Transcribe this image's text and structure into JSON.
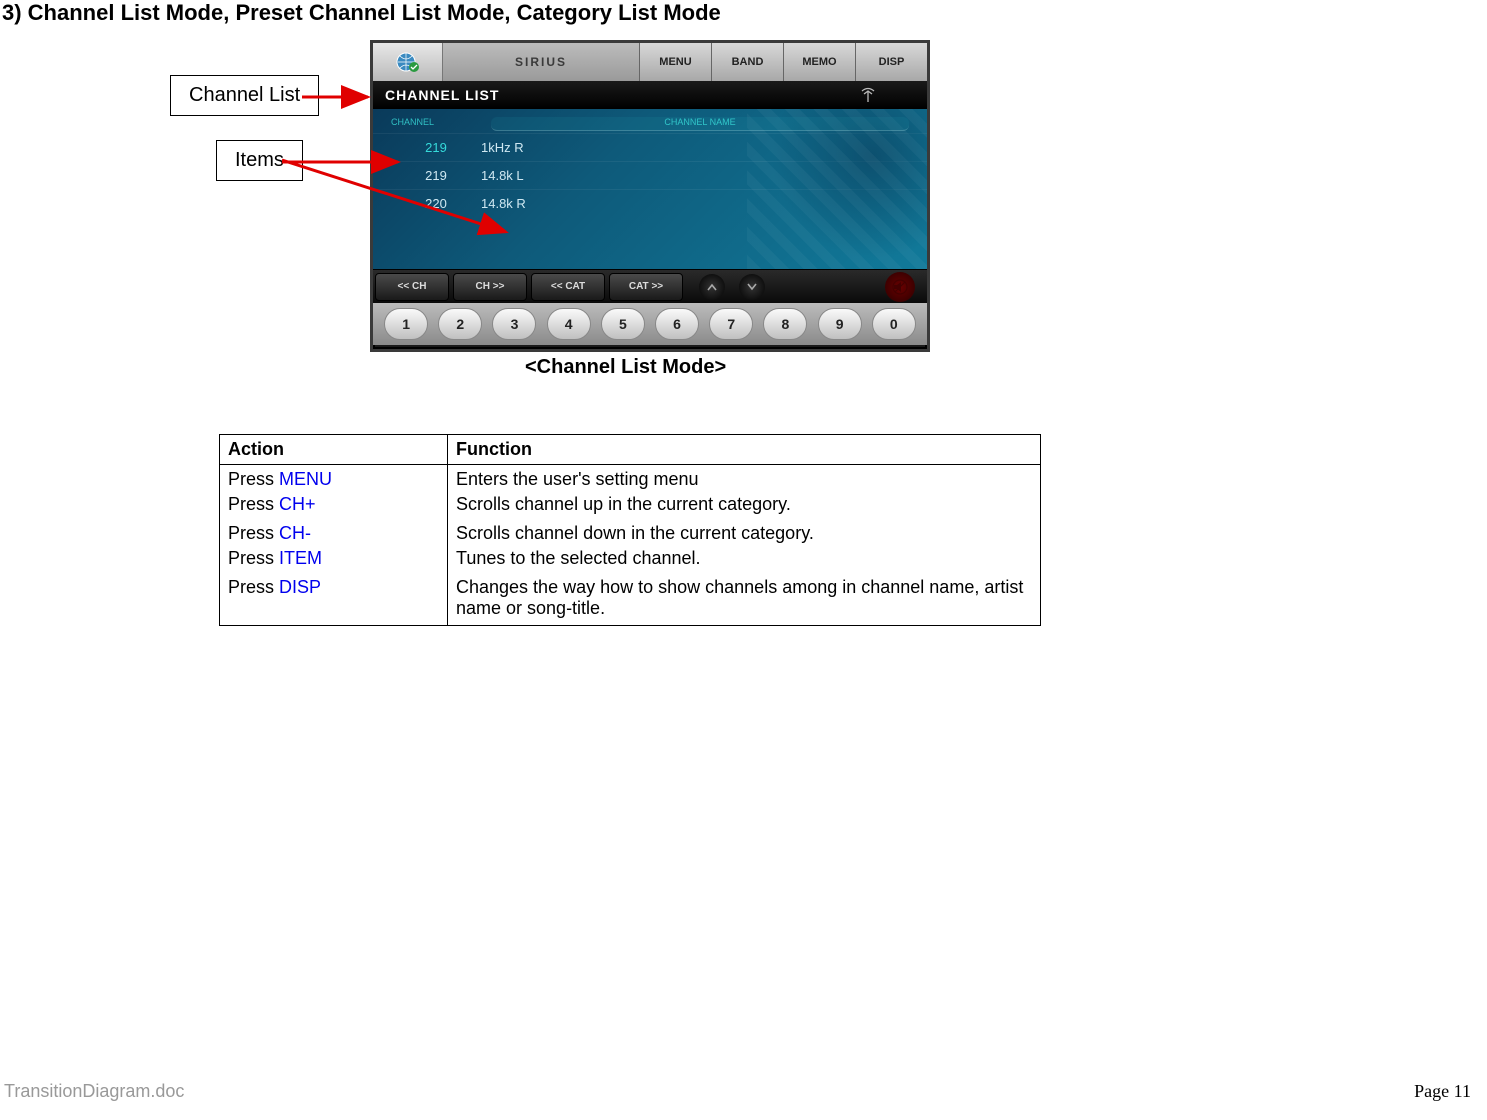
{
  "heading": "3) Channel List Mode, Preset Channel List Mode, Category List Mode",
  "callouts": {
    "channel_list": "Channel List",
    "items": "Items"
  },
  "screenshot": {
    "sirius": "SIRIUS",
    "top_buttons": [
      "MENU",
      "BAND",
      "MEMO",
      "DISP"
    ],
    "title_bar": "CHANNEL LIST",
    "list_header": {
      "ch": "CHANNEL",
      "name": "CHANNEL NAME"
    },
    "rows": [
      {
        "ch": "219",
        "name": "1kHz R"
      },
      {
        "ch": "219",
        "name": "14.8k L"
      },
      {
        "ch": "220",
        "name": "14.8k R"
      }
    ],
    "nav_buttons": [
      "<< CH",
      "CH >>",
      "<< CAT",
      "CAT >>"
    ],
    "numbers": [
      "1",
      "2",
      "3",
      "4",
      "5",
      "6",
      "7",
      "8",
      "9",
      "0"
    ]
  },
  "caption": "<Channel List Mode>",
  "table": {
    "headers": {
      "action": "Action",
      "function": "Function"
    },
    "press": "Press ",
    "rows": [
      {
        "key": "MENU",
        "func": "Enters the user's setting menu"
      },
      {
        "key": "CH+",
        "func": "Scrolls channel up in the current category."
      },
      {
        "key": "CH-",
        "func": "Scrolls channel down in the current category."
      },
      {
        "key": "ITEM",
        "func": "Tunes to the selected channel."
      },
      {
        "key": "DISP",
        "func": "Changes the way how to show channels among in channel name, artist name or song-title."
      }
    ]
  },
  "footer": {
    "filename": "TransitionDiagram.doc",
    "page": "Page 11"
  }
}
